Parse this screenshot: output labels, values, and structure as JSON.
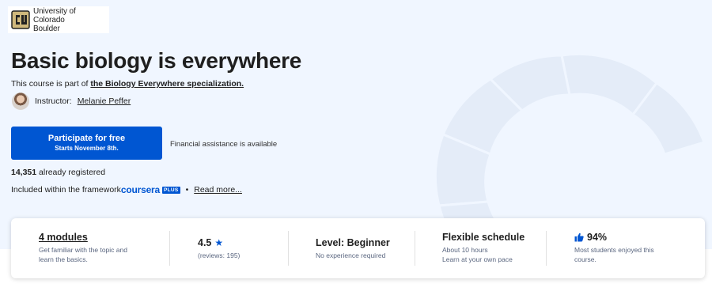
{
  "brand": {
    "university_line1": "University of Colorado",
    "university_line2": "Boulder",
    "logo_icon": "cu-boulder-logo",
    "accent_color": "#0056d2"
  },
  "course": {
    "title": "Basic biology is everywhere",
    "part_of_prefix": "This course is part of ",
    "specialization_link": "the Biology Everywhere specialization.",
    "instructor_label": "Instructor:",
    "instructor_name": "Melanie Peffer"
  },
  "enroll": {
    "button_label": "Participate for free",
    "button_sub": "Starts November 8th.",
    "financial_aid": "Financial assistance is available",
    "registered_count": "14,351",
    "registered_text": " already registered",
    "included_text": "Included within the framework",
    "coursera_word": "coursera",
    "plus_badge": "PLUS",
    "bullet": "•",
    "read_more": "Read more..."
  },
  "stats": {
    "modules_title": "4 modules",
    "modules_sub_1": "Get familiar with the topic and",
    "modules_sub_2": "learn the basics.",
    "rating_value": "4.5",
    "rating_star": "★",
    "rating_reviews": "(reviews: 195)",
    "level_title": "Level: Beginner",
    "level_sub": "No experience required",
    "schedule_title": "Flexible schedule",
    "schedule_sub_1": "About 10 hours",
    "schedule_sub_2": "Learn at your own pace",
    "enjoy_pct": "94%",
    "enjoy_sub_1": "Most students enjoyed this",
    "enjoy_sub_2": "course."
  }
}
